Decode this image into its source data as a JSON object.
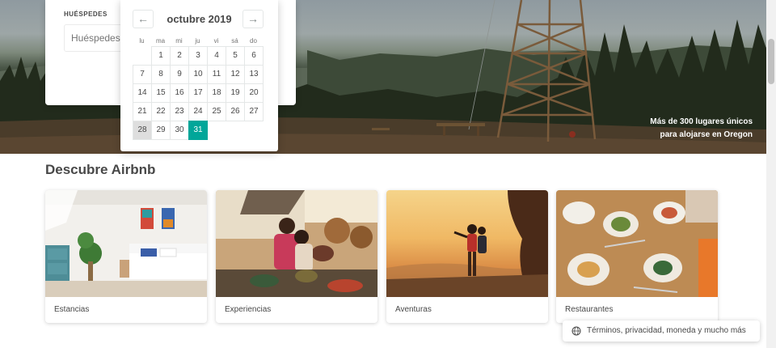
{
  "search": {
    "guests_label": "HUÉSPEDES",
    "guests_placeholder": "Huéspedes"
  },
  "calendar": {
    "month_title": "octubre 2019",
    "prev_icon": "arrow-left-icon",
    "next_icon": "arrow-right-icon",
    "prev_glyph": "←",
    "next_glyph": "→",
    "weekdays": [
      "lu",
      "ma",
      "mi",
      "ju",
      "vi",
      "sá",
      "do"
    ],
    "days": [
      "1",
      "2",
      "3",
      "4",
      "5",
      "6",
      "7",
      "8",
      "9",
      "10",
      "11",
      "12",
      "13",
      "14",
      "15",
      "16",
      "17",
      "18",
      "19",
      "20",
      "21",
      "22",
      "23",
      "24",
      "25",
      "26",
      "27",
      "28",
      "29",
      "30",
      "31"
    ],
    "leading_blanks": 1,
    "blocked_day": "28",
    "selected_day": "31",
    "selected_color": "#00a699"
  },
  "hero": {
    "caption_line1": "Más de 300 lugares únicos",
    "caption_line2": "para alojarse en Oregon"
  },
  "discover": {
    "title": "Descubre Airbnb",
    "cards": [
      {
        "label": "Estancias"
      },
      {
        "label": "Experiencias"
      },
      {
        "label": "Aventuras"
      },
      {
        "label": "Restaurantes"
      }
    ]
  },
  "footer": {
    "icon": "globe-icon",
    "text": "Términos, privacidad, moneda y mucho más"
  }
}
